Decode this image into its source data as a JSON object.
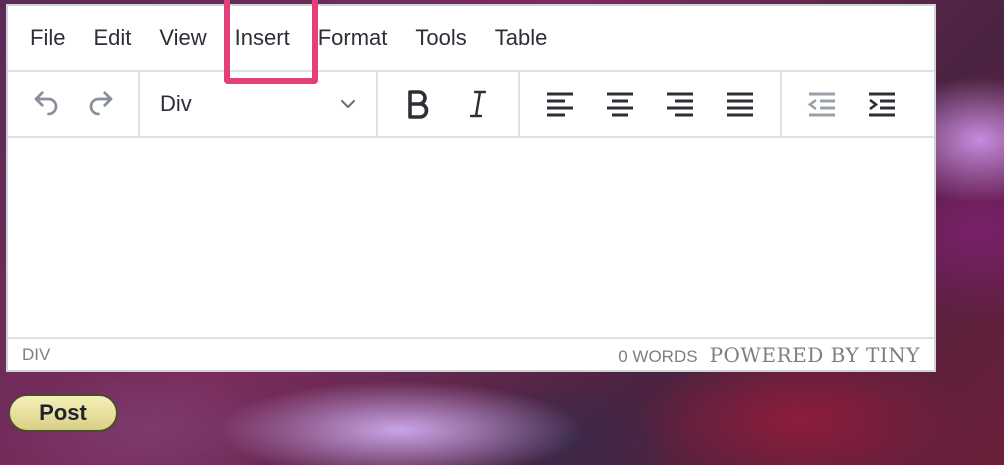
{
  "menubar": {
    "items": [
      {
        "label": "File"
      },
      {
        "label": "Edit"
      },
      {
        "label": "View"
      },
      {
        "label": "Insert"
      },
      {
        "label": "Format"
      },
      {
        "label": "Tools"
      },
      {
        "label": "Table"
      }
    ],
    "highlighted_item": "Insert",
    "highlight_color": "#e3407a"
  },
  "toolbar": {
    "history": [
      "undo-icon",
      "redo-icon"
    ],
    "block_format": {
      "value": "Div"
    },
    "formatting": [
      "bold-icon",
      "italic-icon"
    ],
    "alignment": [
      "align-left-icon",
      "align-center-icon",
      "align-right-icon",
      "align-justify-icon"
    ],
    "indent": [
      "outdent-icon",
      "indent-icon"
    ]
  },
  "statusbar": {
    "path": "DIV",
    "word_count": "0 WORDS",
    "branding": "POWERED BY TINY"
  },
  "post_button": {
    "label": "Post"
  }
}
